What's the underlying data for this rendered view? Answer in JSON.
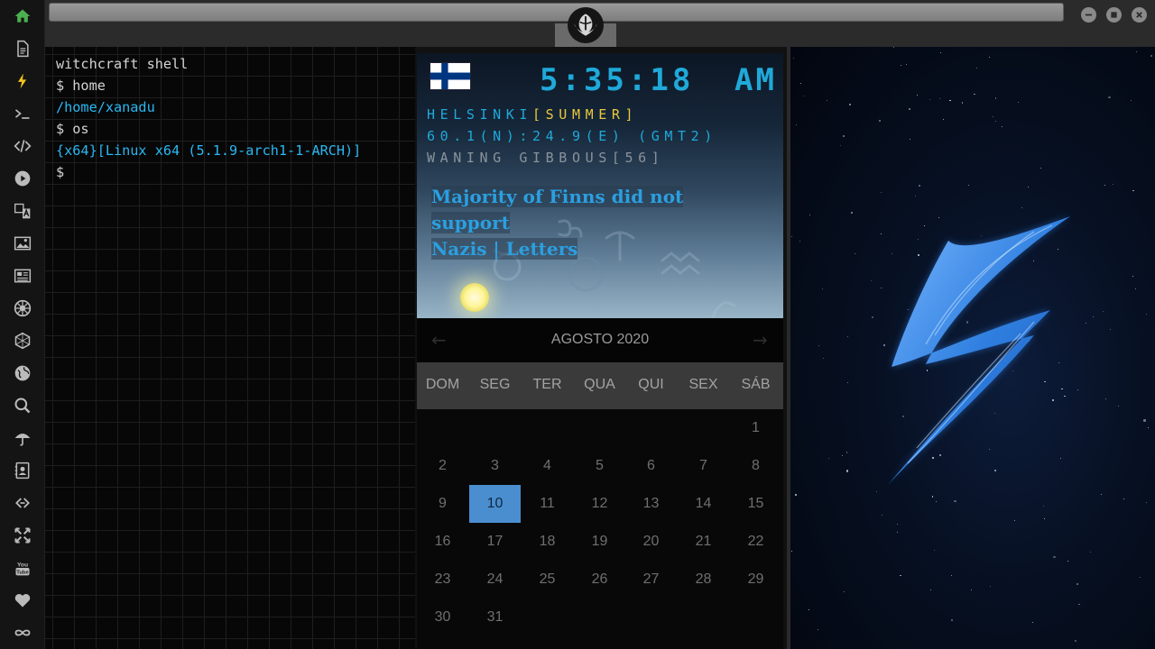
{
  "window": {
    "controls": [
      "minimize",
      "maximize",
      "close"
    ]
  },
  "sidebar": {
    "items": [
      {
        "icon": "home-icon",
        "color": "#4caf50"
      },
      {
        "icon": "document-icon"
      },
      {
        "icon": "lightning-icon",
        "color": "#f0c419"
      },
      {
        "icon": "terminal-icon"
      },
      {
        "icon": "code-icon"
      },
      {
        "icon": "play-icon"
      },
      {
        "icon": "translate-icon"
      },
      {
        "icon": "image-icon"
      },
      {
        "icon": "newspaper-icon"
      },
      {
        "icon": "galactic-empire-icon"
      },
      {
        "icon": "hexagon-network-icon"
      },
      {
        "icon": "globe-icon"
      },
      {
        "icon": "search-icon"
      },
      {
        "icon": "umbrella-icon"
      },
      {
        "icon": "contacts-icon"
      },
      {
        "icon": "link-icon"
      },
      {
        "icon": "expand-icon"
      },
      {
        "icon": "youtube-icon"
      },
      {
        "icon": "heart-icon"
      },
      {
        "icon": "infinity-icon"
      }
    ]
  },
  "terminal": {
    "lines": [
      {
        "text": "witchcraft shell",
        "color": "#d4d4d4"
      },
      {
        "text": "$ home",
        "color": "#d4d4d4"
      },
      {
        "text": "/home/xanadu",
        "color": "#29b8f2"
      },
      {
        "text": "$ os",
        "color": "#d4d4d4"
      },
      {
        "text": "{x64}[Linux x64 (5.1.9-arch1-1-ARCH)]",
        "color": "#29b8f2"
      },
      {
        "text": "$",
        "color": "#d4d4d4"
      }
    ]
  },
  "widget": {
    "time": "5:35:18",
    "ampm": "AM",
    "city": "HELSINKI",
    "season": "[SUMMER]",
    "coords": "60.1(N):24.9(E) (GMT2)",
    "moon": "WANING GIBBOUS[56]",
    "headline_line1": "Majority of Finns did not support",
    "headline_line2": "Nazis | Letters",
    "flag": "finland-flag",
    "colors": {
      "clock": "#1fa9d9",
      "season": "#e8c93a",
      "headline": "#2b9fe0"
    }
  },
  "calendar": {
    "title": "AGOSTO 2020",
    "weekdays": [
      "DOM",
      "SEG",
      "TER",
      "QUA",
      "QUI",
      "SEX",
      "SÁB"
    ],
    "days": [
      "1",
      "2",
      "3",
      "4",
      "5",
      "6",
      "7",
      "8",
      "9",
      "10",
      "11",
      "12",
      "13",
      "14",
      "15",
      "16",
      "17",
      "18",
      "19",
      "20",
      "21",
      "22",
      "23",
      "24",
      "25",
      "26",
      "27",
      "28",
      "29",
      "30",
      "31"
    ],
    "first_weekday_index": 6,
    "selected_day": "10",
    "colors": {
      "selected": "#4a8ed0"
    }
  },
  "wallpaper": {
    "graphic": "lightning-bolt",
    "color": "#2f7fe0"
  }
}
